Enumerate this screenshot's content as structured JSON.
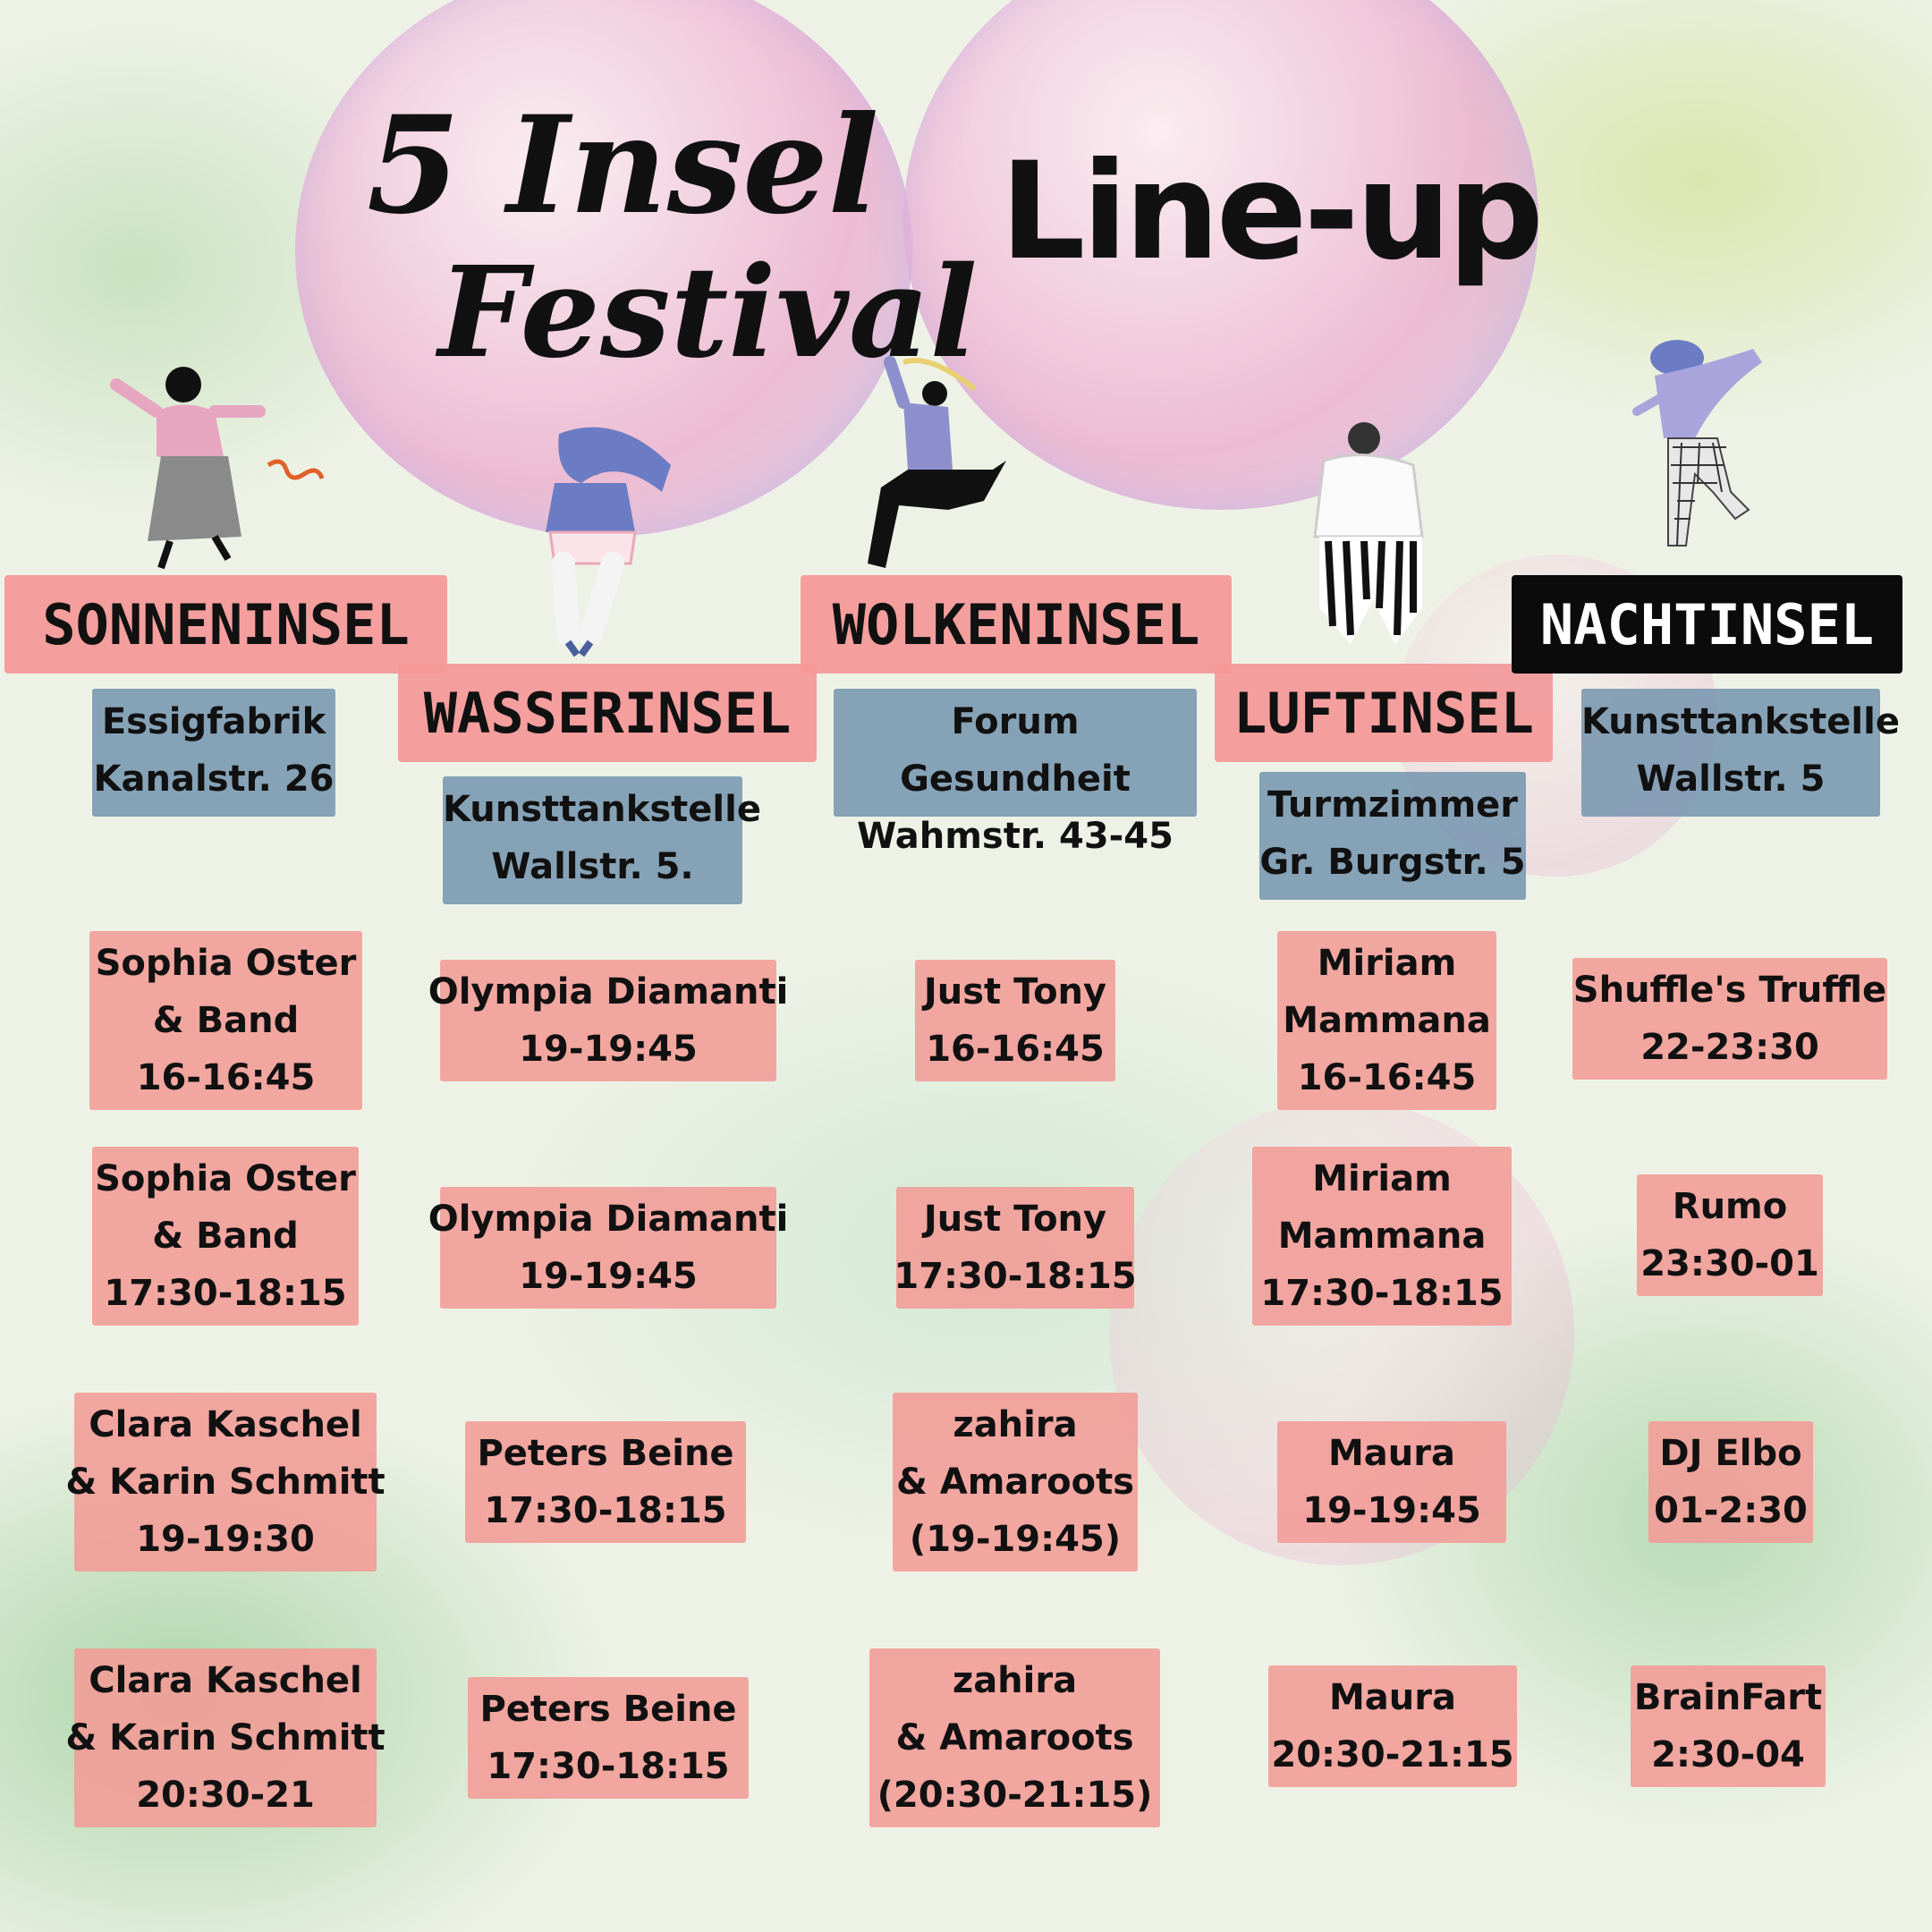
{
  "poster": {
    "title_line1": "5 Insel",
    "title_line2": "Festival",
    "lineup": "Line-up"
  },
  "islands": [
    {
      "name": "SONNENINSEL",
      "venue": "Essigfabrik",
      "address": "Kanalstr. 26",
      "acts": [
        {
          "lines": [
            "Sophia Oster",
            "& Band"
          ],
          "time": "16-16:45"
        },
        {
          "lines": [
            "Sophia Oster",
            "& Band"
          ],
          "time": "17:30-18:15"
        },
        {
          "lines": [
            "Clara Kaschel",
            "& Karin Schmitt"
          ],
          "time": "19-19:30"
        },
        {
          "lines": [
            "Clara Kaschel",
            "& Karin Schmitt"
          ],
          "time": "20:30-21"
        }
      ]
    },
    {
      "name": "WASSERINSEL",
      "venue": "Kunsttankstelle",
      "address": "Wallstr. 5.",
      "acts": [
        {
          "lines": [
            "Olympia Diamanti"
          ],
          "time": "19-19:45"
        },
        {
          "lines": [
            "Olympia Diamanti"
          ],
          "time": "19-19:45"
        },
        {
          "lines": [
            "Peters Beine"
          ],
          "time": "17:30-18:15"
        },
        {
          "lines": [
            "Peters Beine"
          ],
          "time": "17:30-18:15"
        }
      ]
    },
    {
      "name": "WOLKENINSEL",
      "venue": "Forum Gesundheit",
      "address": "Wahmstr. 43-45",
      "acts": [
        {
          "lines": [
            "Just Tony"
          ],
          "time": "16-16:45"
        },
        {
          "lines": [
            "Just Tony"
          ],
          "time": "17:30-18:15"
        },
        {
          "lines": [
            "zahira",
            "& Amaroots"
          ],
          "time": "(19-19:45)"
        },
        {
          "lines": [
            "zahira",
            "& Amaroots"
          ],
          "time": "(20:30-21:15)"
        }
      ]
    },
    {
      "name": "LUFTINSEL",
      "venue": "Turmzimmer",
      "address": "Gr. Burgstr. 5",
      "acts": [
        {
          "lines": [
            "Miriam",
            "Mammana"
          ],
          "time": "16-16:45"
        },
        {
          "lines": [
            "Miriam",
            "Mammana"
          ],
          "time": "17:30-18:15"
        },
        {
          "lines": [
            "Maura"
          ],
          "time": "19-19:45"
        },
        {
          "lines": [
            "Maura"
          ],
          "time": "20:30-21:15"
        }
      ]
    },
    {
      "name": "NACHTINSEL",
      "venue": "Kunsttankstelle",
      "address": "Wallstr. 5",
      "acts": [
        {
          "lines": [
            "Shuffle's Truffle"
          ],
          "time": "22-23:30"
        },
        {
          "lines": [
            "Rumo"
          ],
          "time": "23:30-01"
        },
        {
          "lines": [
            "DJ Elbo"
          ],
          "time": "01-2:30"
        },
        {
          "lines": [
            "BrainFart"
          ],
          "time": "2:30-04"
        }
      ]
    }
  ],
  "colors": {
    "header_pink": "#f49898",
    "header_dark": "#0b0b0b",
    "venue_blue": "#7896af",
    "act_salmon": "#f39b96",
    "bubble_pink": "#ecaacd"
  },
  "icons": [
    "dancer-1-icon",
    "dancer-2-icon",
    "dancer-3-icon",
    "dancer-4-icon",
    "dancer-5-icon"
  ]
}
